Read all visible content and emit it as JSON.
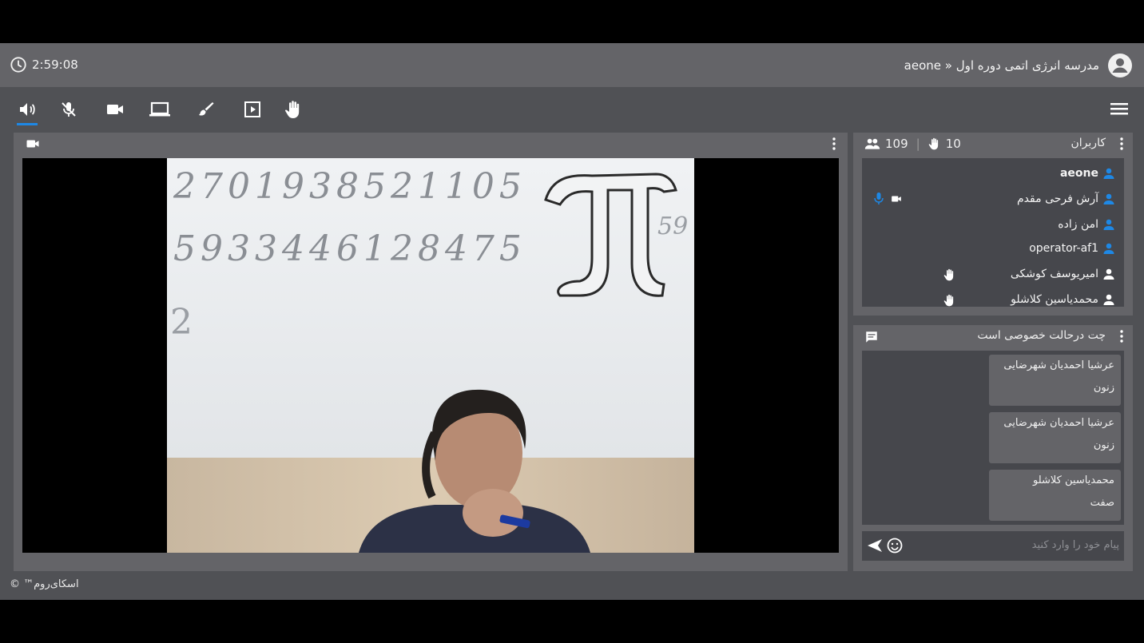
{
  "header": {
    "clock": "2:59:08",
    "title": "aeone » مدرسه انرژی اتمی دوره اول",
    "user_icon": "account-circle-icon"
  },
  "toolbar": {
    "tools": [
      {
        "name": "speaker-icon",
        "active": true
      },
      {
        "name": "mic-off-icon"
      },
      {
        "name": "camera-icon"
      },
      {
        "name": "screen-share-icon"
      },
      {
        "name": "whiteboard-brush-icon"
      },
      {
        "name": "media-play-icon"
      },
      {
        "name": "raise-hand-icon"
      }
    ],
    "menu_icon": "hamburger-menu-icon"
  },
  "video": {
    "header_icon": "camera-icon",
    "board_digits_line1": "2701938521105",
    "board_digits_line2": "5933446128475",
    "board_digits_left": "2",
    "board_digits_right": "59"
  },
  "users_panel": {
    "title": "کاربران",
    "total_count": "109",
    "hands_count": "10",
    "users": [
      {
        "name": "aeone",
        "bold": true,
        "color": "#1e88e5"
      },
      {
        "name": "آرش فرحی مقدم",
        "color": "#1e88e5",
        "mic": true,
        "cam": true
      },
      {
        "name": "امن زاده",
        "color": "#1e88e5"
      },
      {
        "name": "operator-af1",
        "color": "#1e88e5"
      },
      {
        "name": "امیریوسف کوشکی",
        "color": "#ffffff",
        "hand": true
      },
      {
        "name": "محمدیاسین کلاشلو",
        "color": "#ffffff",
        "hand": true
      }
    ]
  },
  "chat_panel": {
    "title": "چت درحالت خصوصی است",
    "messages": [
      {
        "author": "عرشیا احمدیان شهرضایی",
        "text": "زنون"
      },
      {
        "author": "عرشیا احمدیان شهرضایی",
        "text": "زنون"
      },
      {
        "author": "محمدیاسین کلاشلو",
        "text": "صفت"
      }
    ],
    "input_placeholder": "پیام خود را وارد کنید"
  },
  "footer": {
    "copyright": "اسکای‌روم™ ©"
  },
  "colors": {
    "accent": "#1e88e5",
    "panel": "#646468",
    "background": "#505155",
    "list_bg": "#46474c"
  }
}
